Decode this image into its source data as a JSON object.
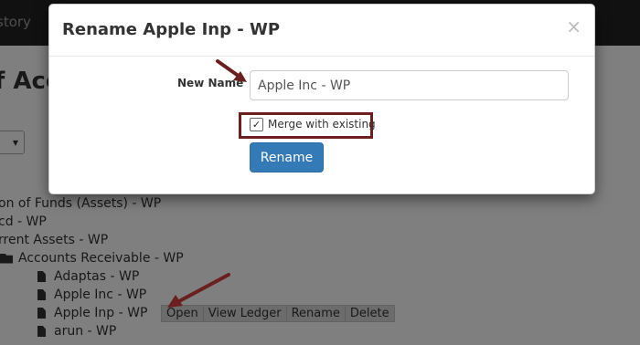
{
  "navbar": {
    "item": "story"
  },
  "page": {
    "title": "f Acco"
  },
  "tree": {
    "rows": [
      "on of Funds (Assets) - WP",
      "cd - WP",
      "rrent Assets - WP",
      "Accounts Receivable - WP",
      "Adaptas - WP",
      "Apple Inc - WP",
      "Apple Inp - WP",
      "arun - WP"
    ],
    "actions": [
      "Open",
      "View Ledger",
      "Rename",
      "Delete"
    ]
  },
  "modal": {
    "title": "Rename Apple Inp - WP",
    "close": "×",
    "new_name_label": "New Name",
    "new_name_value": "Apple Inc - WP",
    "merge_label": "Merge with existing",
    "merge_checked": "✓",
    "rename_button": "Rename"
  },
  "colors": {
    "primary": "#337ab7",
    "annotation": "#6b1f1f",
    "navbar": "#222222"
  }
}
